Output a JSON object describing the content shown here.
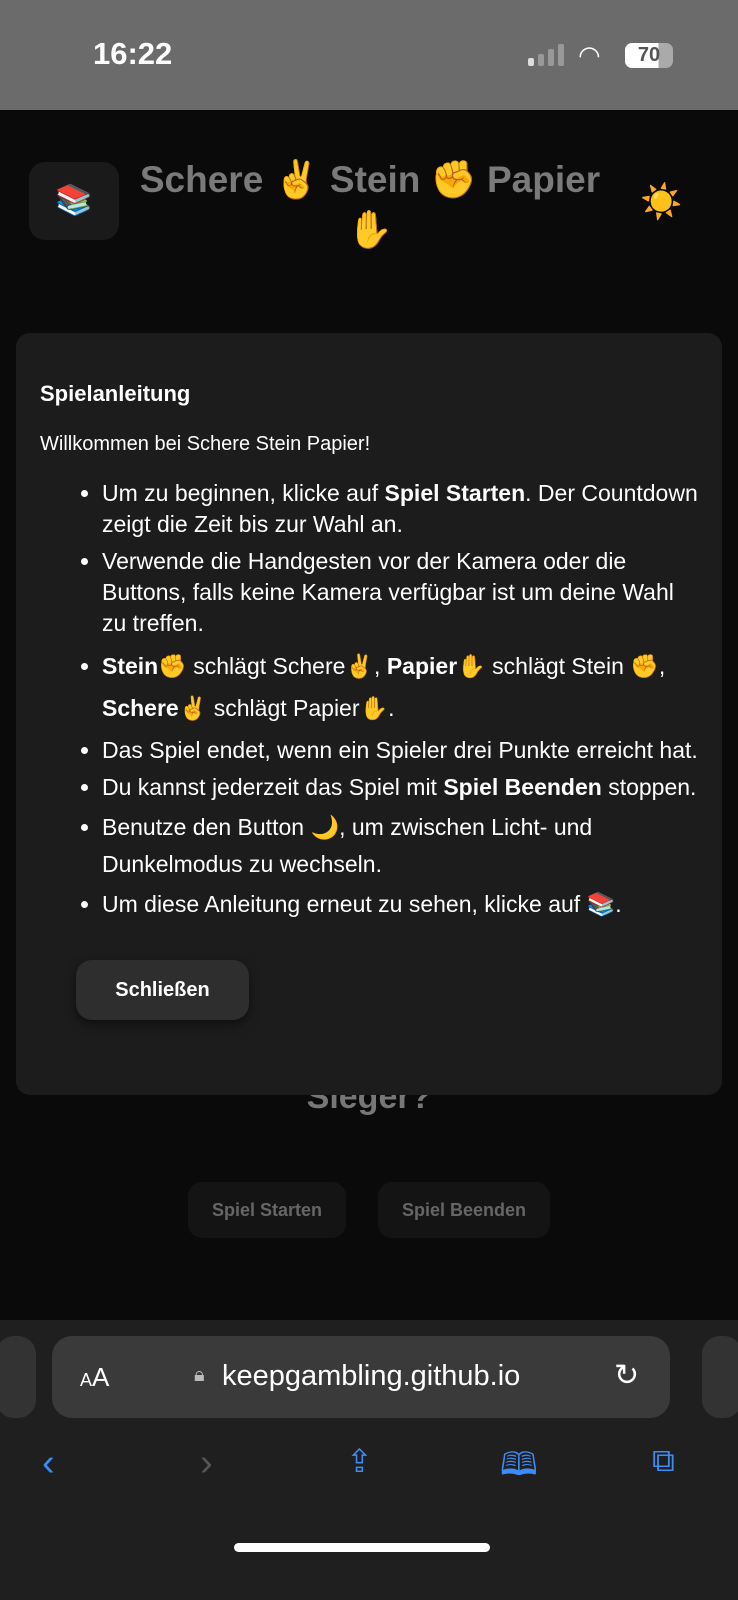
{
  "status_bar": {
    "time": "16:22",
    "battery": "70"
  },
  "header": {
    "help_icon": "📚",
    "title": "Schere ✌️ Stein ✊ Papier ✋",
    "theme_icon": "☀️"
  },
  "background": {
    "winner_text": "Sieger?",
    "start_label": "Spiel Starten",
    "end_label": "Spiel Beenden"
  },
  "modal": {
    "title": "Spielanleitung",
    "intro": "Willkommen bei Schere Stein Papier!",
    "items": [
      {
        "parts": [
          "Um zu beginnen, klicke auf ",
          "Spiel Starten",
          ". Der Countdown zeigt die Zeit bis zur Wahl an."
        ]
      },
      {
        "parts": [
          "Verwende die Handgesten vor der Kamera oder die Buttons, falls keine Kamera verfügbar ist um deine Wahl zu treffen."
        ]
      },
      {
        "parts": [
          "Stein✊",
          " schlägt Schere✌️, ",
          "Papier✋",
          " schlägt Stein ✊, ",
          "Schere✌️",
          " schlägt Papier✋."
        ]
      },
      {
        "parts": [
          "Das Spiel endet, wenn ein Spieler drei Punkte erreicht hat."
        ]
      },
      {
        "parts": [
          "Du kannst jederzeit das Spiel mit ",
          "Spiel Beenden",
          " stoppen."
        ]
      },
      {
        "parts": [
          "Benutze den Button 🌙, um zwischen Licht- und Dunkelmodus zu wechseln."
        ]
      },
      {
        "parts": [
          "Um diese Anleitung erneut zu sehen, klicke auf 📚."
        ]
      }
    ],
    "close_label": "Schließen"
  },
  "browser": {
    "aa_small": "A",
    "aa_large": "A",
    "url": "keepgambling.github.io"
  }
}
